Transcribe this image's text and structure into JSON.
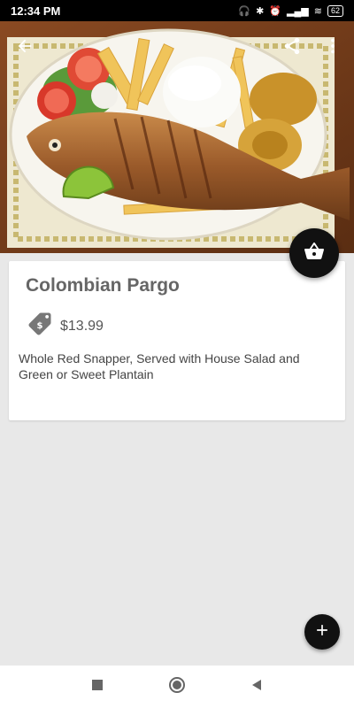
{
  "status_bar": {
    "time": "12:34 PM",
    "battery": "62"
  },
  "item": {
    "name": "Colombian Pargo",
    "price": "$13.99",
    "description": "Whole Red Snapper, Served with House Salad and Green or Sweet Plantain"
  },
  "icons": {
    "back": "arrow-left-icon",
    "share": "share-icon",
    "menu": "more-vert-icon",
    "basket": "basket-icon",
    "price_tag": "price-tag-icon",
    "add": "plus-icon"
  },
  "colors": {
    "fab": "#111111",
    "title": "#666666",
    "background": "#e8e8e8"
  }
}
